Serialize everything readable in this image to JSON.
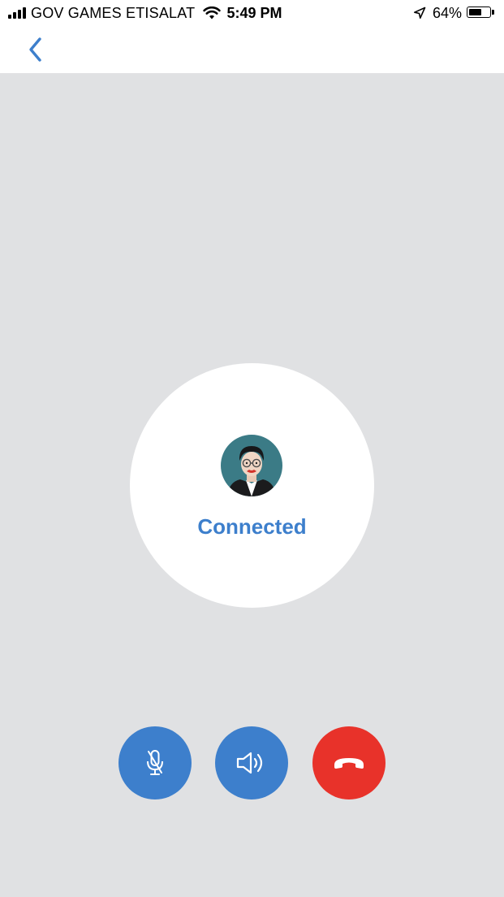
{
  "status_bar": {
    "carrier": "GOV GAMES ETISALAT",
    "time": "5:49 PM",
    "battery_percent": "64%",
    "battery_level": 0.64,
    "signal_bars": 4,
    "icons": [
      "signal-icon",
      "wifi-icon",
      "location-arrow-icon",
      "battery-icon"
    ]
  },
  "nav": {
    "back_icon": "chevron-left-icon"
  },
  "call": {
    "status": "Connected",
    "avatar_icon": "user-avatar"
  },
  "controls": {
    "mute_icon": "microphone-off-icon",
    "speaker_icon": "speaker-icon",
    "hangup_icon": "phone-hangup-icon"
  },
  "colors": {
    "accent": "#3d7fcc",
    "hangup": "#e8322a",
    "background": "#e0e1e3",
    "surface": "#ffffff"
  }
}
